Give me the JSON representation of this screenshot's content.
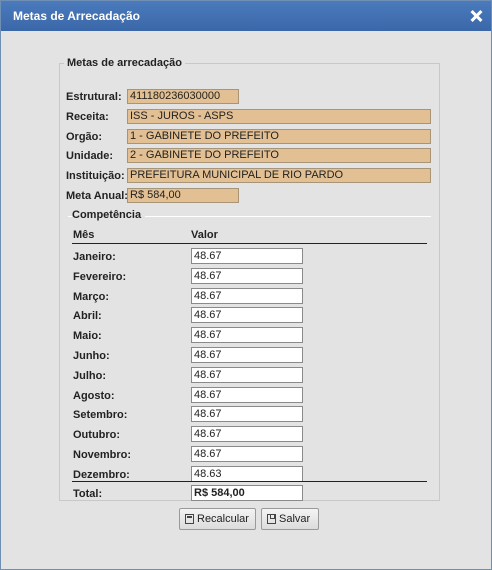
{
  "dialog": {
    "title": "Metas de Arrecadação"
  },
  "section": {
    "legend": "Metas de arrecadação"
  },
  "fields": {
    "estrutural": {
      "label": "Estrutural:",
      "value": "411180236030000"
    },
    "receita": {
      "label": "Receita:",
      "value": "ISS - JUROS - ASPS"
    },
    "orgao": {
      "label": "Orgão:",
      "value": "1 - GABINETE DO PREFEITO"
    },
    "unidade": {
      "label": "Unidade:",
      "value": "2 - GABINETE DO PREFEITO"
    },
    "instituicao": {
      "label": "Instituição:",
      "value": "PREFEITURA MUNICIPAL DE RIO PARDO"
    },
    "meta_anual": {
      "label": "Meta Anual:",
      "value": "R$ 584,00"
    }
  },
  "competencia": {
    "legend": "Competência",
    "headers": {
      "mes": "Mês",
      "valor": "Valor"
    },
    "months": [
      {
        "label": "Janeiro:",
        "value": "48.67"
      },
      {
        "label": "Fevereiro:",
        "value": "48.67"
      },
      {
        "label": "Março:",
        "value": "48.67"
      },
      {
        "label": "Abril:",
        "value": "48.67"
      },
      {
        "label": "Maio:",
        "value": "48.67"
      },
      {
        "label": "Junho:",
        "value": "48.67"
      },
      {
        "label": "Julho:",
        "value": "48.67"
      },
      {
        "label": "Agosto:",
        "value": "48.67"
      },
      {
        "label": "Setembro:",
        "value": "48.67"
      },
      {
        "label": "Outubro:",
        "value": "48.67"
      },
      {
        "label": "Novembro:",
        "value": "48.67"
      },
      {
        "label": "Dezembro:",
        "value": "48.63"
      }
    ],
    "total": {
      "label": "Total:",
      "value": "R$ 584,00"
    }
  },
  "buttons": {
    "recalcular": "Recalcular",
    "salvar": "Salvar"
  },
  "icons": {
    "close": "close-icon",
    "calc": "calculator-icon",
    "save": "save-icon"
  },
  "colors": {
    "titlebar": "#3f6fb0",
    "readonly_field": "#e3c093",
    "dialog_bg": "#e3e3e3"
  }
}
